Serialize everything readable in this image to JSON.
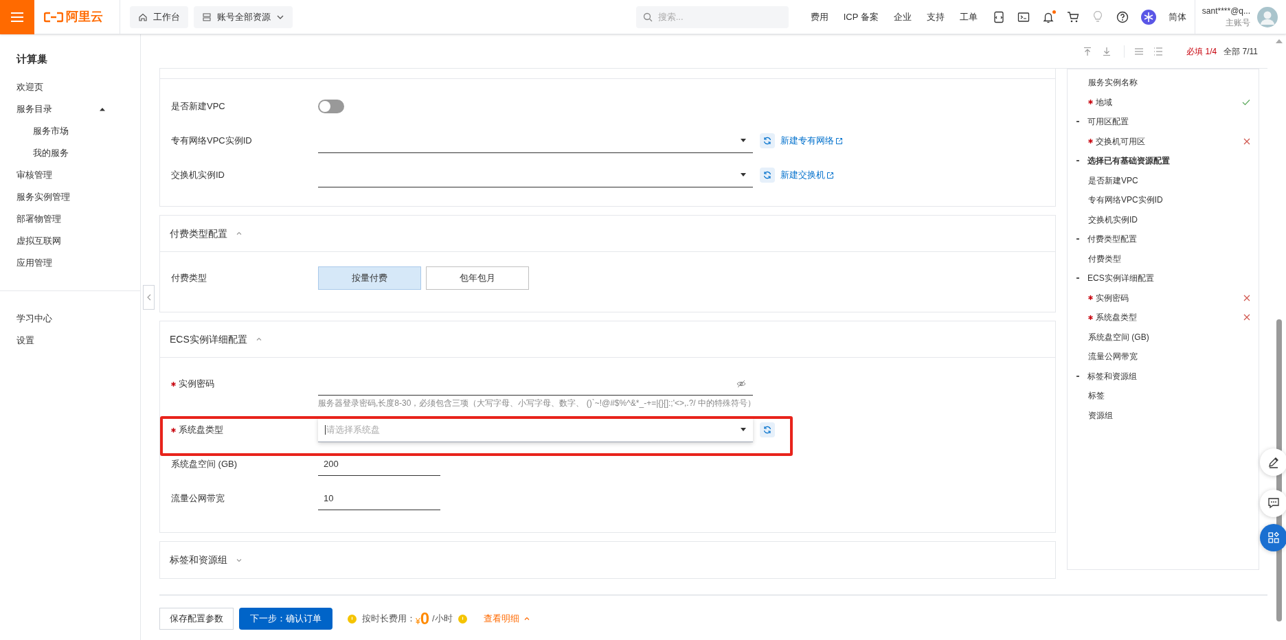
{
  "topbar": {
    "logo": "阿里云",
    "workbench": "工作台",
    "resources": "账号全部资源",
    "search_placeholder": "搜索...",
    "links": [
      "费用",
      "ICP 备案",
      "企业",
      "支持",
      "工单"
    ],
    "notifications_unread": true,
    "language": "简体",
    "account": "sant****@q...",
    "account_type": "主账号"
  },
  "sidebar": {
    "title": "计算巢",
    "items": [
      {
        "label": "欢迎页"
      },
      {
        "label": "服务目录",
        "expanded": true,
        "children": [
          {
            "label": "服务市场"
          },
          {
            "label": "我的服务"
          }
        ]
      },
      {
        "label": "审核管理"
      },
      {
        "label": "服务实例管理"
      },
      {
        "label": "部署物管理"
      },
      {
        "label": "虚拟互联网"
      },
      {
        "label": "应用管理"
      }
    ],
    "footer_items": [
      {
        "label": "学习中心"
      },
      {
        "label": "设置"
      }
    ]
  },
  "toolbar": {
    "required_progress": {
      "text": "必填 1/4",
      "warning": true
    },
    "all_progress": {
      "text": "全部 7/11",
      "warning": false
    }
  },
  "sections": [
    {
      "fields": [
        {
          "kind": "switch",
          "label": "是否新建VPC",
          "required": false,
          "on": false
        },
        {
          "kind": "select",
          "label": "专有网络VPC实例ID",
          "required": false,
          "link": "新建专有网络"
        },
        {
          "kind": "select",
          "label": "交换机实例ID",
          "required": false,
          "link": "新建交换机"
        }
      ]
    },
    {
      "title": "付费类型配置",
      "expanded": true,
      "fields": [
        {
          "kind": "segmented",
          "label": "付费类型",
          "required": false,
          "options": [
            {
              "label": "按量付费",
              "selected": true
            },
            {
              "label": "包年包月",
              "selected": false
            }
          ]
        }
      ]
    },
    {
      "title": "ECS实例详细配置",
      "expanded": true,
      "fields": [
        {
          "kind": "password",
          "label": "实例密码",
          "required": true,
          "hint": "服务器登录密码,长度8-30，必须包含三项（大写字母、小写字母、数字、 ()`~!@#$%^&*_-+=|{}[]:;'<>,.?/ 中的特殊符号）"
        },
        {
          "kind": "select",
          "label": "系统盘类型",
          "required": true,
          "placeholder": "请选择系统盘",
          "focused": true,
          "highlighted": true
        },
        {
          "kind": "text",
          "label": "系统盘空间 (GB)",
          "required": false,
          "value": "200"
        },
        {
          "kind": "text",
          "label": "流量公网带宽",
          "required": false,
          "value": "10"
        }
      ]
    },
    {
      "title": "标签和资源组",
      "expanded": false
    }
  ],
  "outline": [
    {
      "label": "服务实例名称",
      "required": false,
      "selected": false
    },
    {
      "label": "地域",
      "required": true,
      "valid": true,
      "selected": false
    },
    {
      "label": "可用区配置",
      "selected": false,
      "children": [
        {
          "label": "交换机可用区",
          "required": true,
          "valid": false,
          "selected": false
        }
      ]
    },
    {
      "label": "选择已有基础资源配置",
      "selected": true,
      "children": [
        {
          "label": "是否新建VPC",
          "required": false,
          "selected": false
        },
        {
          "label": "专有网络VPC实例ID",
          "required": false,
          "selected": false
        },
        {
          "label": "交换机实例ID",
          "required": false,
          "selected": false
        }
      ]
    },
    {
      "label": "付费类型配置",
      "selected": false,
      "children": [
        {
          "label": "付费类型",
          "required": false,
          "selected": false
        }
      ]
    },
    {
      "label": "ECS实例详细配置",
      "selected": false,
      "children": [
        {
          "label": "实例密码",
          "required": true,
          "valid": false,
          "selected": false
        },
        {
          "label": "系统盘类型",
          "required": true,
          "valid": false,
          "selected": false
        },
        {
          "label": "系统盘空间 (GB)",
          "required": false,
          "selected": false
        },
        {
          "label": "流量公网带宽",
          "required": false,
          "selected": false
        }
      ]
    },
    {
      "label": "标签和资源组",
      "selected": false,
      "children": [
        {
          "label": "标签",
          "required": false,
          "selected": false
        },
        {
          "label": "资源组",
          "required": false,
          "selected": false
        }
      ]
    }
  ],
  "footer": {
    "save": "保存配置参数",
    "next": "下一步：确认订单",
    "fee_label": "按时长费用：",
    "currency": "¥",
    "price": "0",
    "unit": "/小时",
    "details": "查看明细"
  }
}
